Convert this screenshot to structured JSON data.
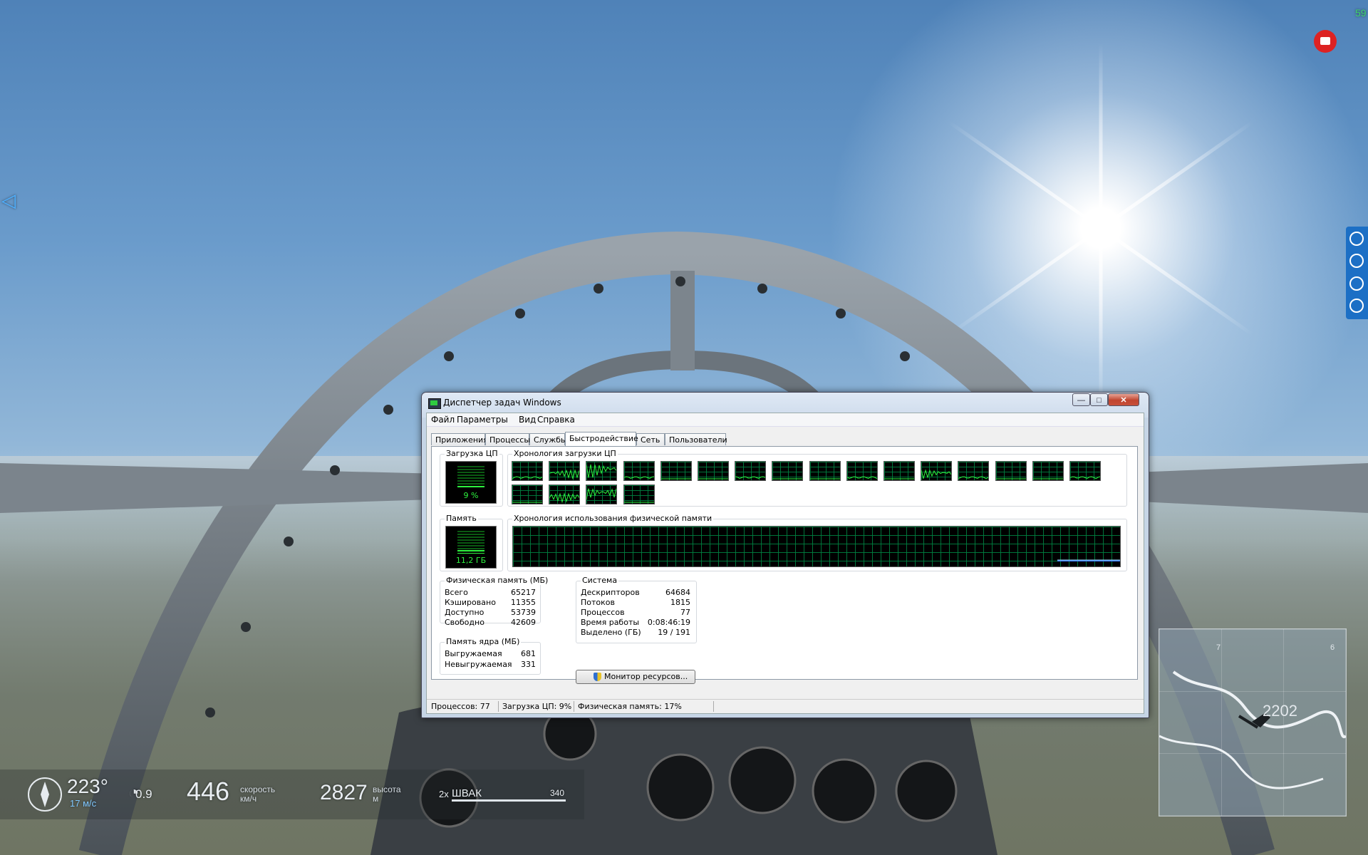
{
  "game": {
    "hud": {
      "heading": "223°",
      "wind": "17 м/с",
      "g_load": "0.9",
      "speed_value": "446",
      "speed_label_1": "скорость",
      "speed_label_2": "км/ч",
      "altitude_value": "2827",
      "altitude_label_1": "высота",
      "altitude_label_2": "м",
      "weapon_count": "2x",
      "weapon_name": "ШВАК",
      "weapon_ammo": "340"
    },
    "minimap": {
      "grid_numbers": [
        "7",
        "6"
      ],
      "marker_altitude": "2202"
    },
    "corner_readout": "59"
  },
  "taskmgr": {
    "title": "Диспетчер задач Windows",
    "window_buttons": {
      "minimize": "—",
      "maximize": "□",
      "close": "✕"
    },
    "menu": [
      "Файл",
      "Параметры",
      "Вид",
      "Справка"
    ],
    "tabs": [
      "Приложения",
      "Процессы",
      "Службы",
      "Быстродействие",
      "Сеть",
      "Пользователи"
    ],
    "active_tab": "Быстродействие",
    "cpu_usage": {
      "label": "Загрузка ЦП",
      "value": "9 %",
      "percent": 9
    },
    "cpu_history": {
      "label": "Хронология загрузки ЦП",
      "core_count": 20
    },
    "memory": {
      "label": "Память",
      "value": "11,2 ГБ",
      "percent": 17
    },
    "memory_history": {
      "label": "Хронология использования физической памяти"
    },
    "physical_memory": {
      "label": "Физическая память (МБ)",
      "rows": [
        {
          "name": "Всего",
          "value": "65217"
        },
        {
          "name": "Кэшировано",
          "value": "11355"
        },
        {
          "name": "Доступно",
          "value": "53739"
        },
        {
          "name": "Свободно",
          "value": "42609"
        }
      ]
    },
    "kernel_memory": {
      "label": "Память ядра (МБ)",
      "rows": [
        {
          "name": "Выгружаемая",
          "value": "681"
        },
        {
          "name": "Невыгружаемая",
          "value": "331"
        }
      ]
    },
    "system": {
      "label": "Система",
      "rows": [
        {
          "name": "Дескрипторов",
          "value": "64684"
        },
        {
          "name": "Потоков",
          "value": "1815"
        },
        {
          "name": "Процессов",
          "value": "77"
        },
        {
          "name": "Время работы",
          "value": "0:08:46:19"
        },
        {
          "name": "Выделено (ГБ)",
          "value": "19 / 191"
        }
      ]
    },
    "resource_monitor_button": "Монитор ресурсов...",
    "status": {
      "processes": "Процессов: 77",
      "cpu": "Загрузка ЦП: 9%",
      "memory": "Физическая память: 17%"
    }
  },
  "colors": {
    "graph_green": "#2ef33f",
    "graph_grid": "#008040",
    "memory_line": "#3a7bff",
    "recorder_red": "#d22222",
    "side_panel_blue": "#1c6fc5"
  }
}
